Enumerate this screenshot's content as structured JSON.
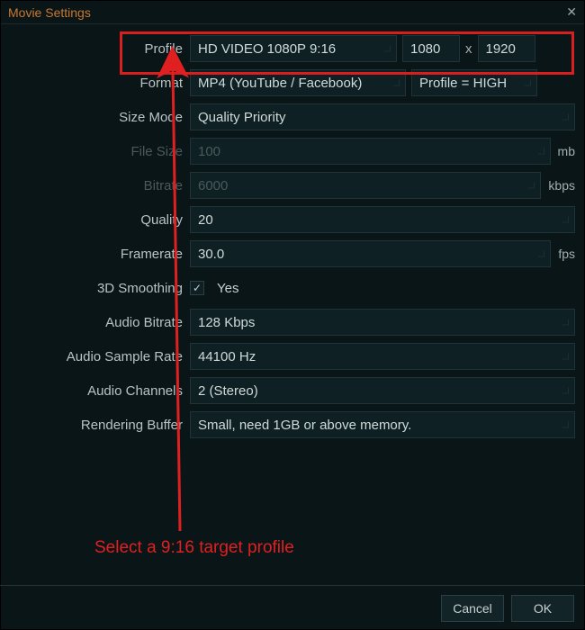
{
  "window": {
    "title": "Movie Settings"
  },
  "labels": {
    "profile": "Profile",
    "format": "Format",
    "size_mode": "Size Mode",
    "file_size": "File Size",
    "bitrate": "Bitrate",
    "quality": "Quality",
    "framerate": "Framerate",
    "smoothing": "3D Smoothing",
    "audio_bitrate": "Audio Bitrate",
    "audio_sample_rate": "Audio Sample Rate",
    "audio_channels": "Audio Channels",
    "rendering_buffer": "Rendering Buffer"
  },
  "values": {
    "profile": "HD VIDEO 1080P 9:16",
    "width": "1080",
    "height": "1920",
    "dim_sep": "x",
    "format": "MP4 (YouTube / Facebook)",
    "profile_level": "Profile = HIGH",
    "size_mode": "Quality Priority",
    "file_size": "100",
    "file_size_unit": "mb",
    "bitrate": "6000",
    "bitrate_unit": "kbps",
    "quality": "20",
    "framerate": "30.0",
    "framerate_unit": "fps",
    "smoothing_checked": "✓",
    "smoothing_label": "Yes",
    "audio_bitrate": "128 Kbps",
    "audio_sample_rate": "44100 Hz",
    "audio_channels": "2 (Stereo)",
    "rendering_buffer": "Small, need 1GB or above memory."
  },
  "annotation": {
    "text": "Select a 9:16 target profile"
  },
  "buttons": {
    "cancel": "Cancel",
    "ok": "OK"
  },
  "colors": {
    "accent": "#c87830",
    "highlight": "#d81e1e",
    "panel": "#0a1518",
    "field": "#0e2024"
  }
}
